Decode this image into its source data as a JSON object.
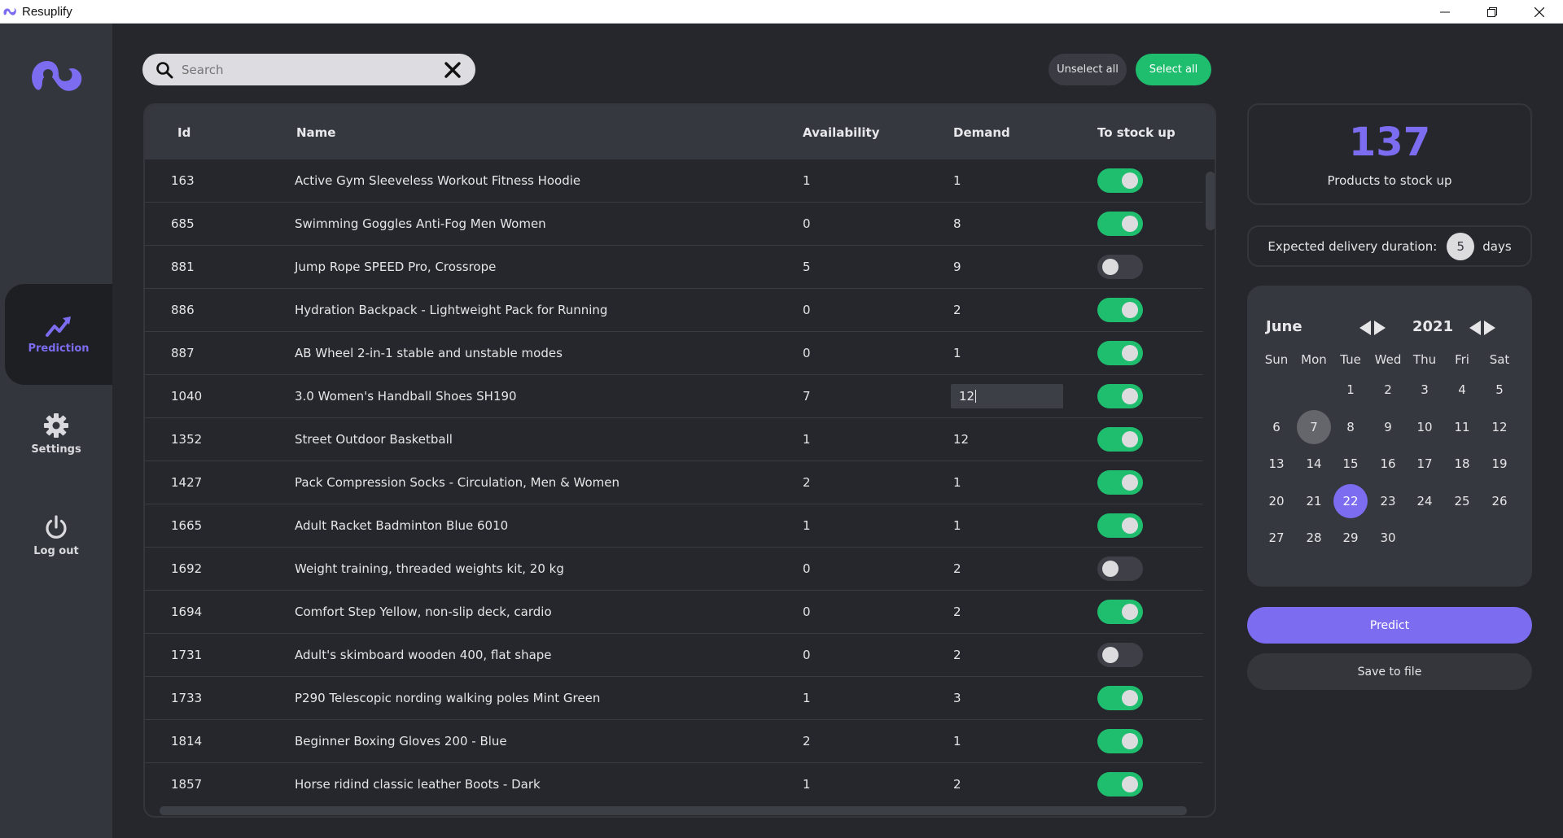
{
  "window": {
    "title": "Resuplify",
    "controls": [
      "minimize-icon",
      "restore-icon",
      "close-icon"
    ]
  },
  "sidebar": {
    "items": [
      {
        "label": "Prediction",
        "icon": "trend-up-icon",
        "active": true
      },
      {
        "label": "Settings",
        "icon": "gear-icon",
        "active": false
      },
      {
        "label": "Log out",
        "icon": "power-icon",
        "active": false
      }
    ]
  },
  "search": {
    "placeholder": "Search",
    "value": ""
  },
  "actions": {
    "unselect_all": "Unselect all",
    "select_all": "Select all"
  },
  "table": {
    "columns": [
      "Id",
      "Name",
      "Availability",
      "Demand",
      "To stock up"
    ],
    "rows": [
      {
        "id": "163",
        "name": "Active Gym Sleeveless Workout Fitness Hoodie",
        "availability": "1",
        "demand": "1",
        "stock": true
      },
      {
        "id": "685",
        "name": "Swimming Goggles Anti-Fog Men Women",
        "availability": "0",
        "demand": "8",
        "stock": true
      },
      {
        "id": "881",
        "name": "Jump Rope SPEED Pro, Crossrope",
        "availability": "5",
        "demand": "9",
        "stock": false
      },
      {
        "id": "886",
        "name": "Hydration Backpack - Lightweight Pack for Running",
        "availability": "0",
        "demand": "2",
        "stock": true
      },
      {
        "id": "887",
        "name": "AB Wheel 2-in-1 stable and unstable modes",
        "availability": "0",
        "demand": "1",
        "stock": true
      },
      {
        "id": "1040",
        "name": "3.0 Women's Handball Shoes SH190",
        "availability": "7",
        "demand": "12",
        "stock": true,
        "editing": true
      },
      {
        "id": "1352",
        "name": "Street Outdoor Basketball",
        "availability": "1",
        "demand": "12",
        "stock": true
      },
      {
        "id": "1427",
        "name": "Pack Compression Socks - Circulation, Men & Women",
        "availability": "2",
        "demand": "1",
        "stock": true
      },
      {
        "id": "1665",
        "name": "Adult Racket Badminton Blue 6010",
        "availability": "1",
        "demand": "1",
        "stock": true
      },
      {
        "id": "1692",
        "name": "Weight training, threaded weights kit, 20 kg",
        "availability": "0",
        "demand": "2",
        "stock": false
      },
      {
        "id": "1694",
        "name": "Comfort Step Yellow, non-slip deck, cardio",
        "availability": "0",
        "demand": "2",
        "stock": true
      },
      {
        "id": "1731",
        "name": "Adult's skimboard wooden 400, flat shape",
        "availability": "0",
        "demand": "2",
        "stock": false
      },
      {
        "id": "1733",
        "name": "P290 Telescopic nording walking poles Mint Green",
        "availability": "1",
        "demand": "3",
        "stock": true
      },
      {
        "id": "1814",
        "name": "Beginner Boxing Gloves 200 - Blue",
        "availability": "2",
        "demand": "1",
        "stock": true
      },
      {
        "id": "1857",
        "name": "Horse ridind classic leather Boots - Dark",
        "availability": "1",
        "demand": "2",
        "stock": true
      }
    ]
  },
  "summary": {
    "count": "137",
    "label": "Products to stock up"
  },
  "delivery": {
    "label": "Expected delivery duration:",
    "value": "5",
    "unit": "days"
  },
  "calendar": {
    "month": "June",
    "year": "2021",
    "weekdays": [
      "Sun",
      "Mon",
      "Tue",
      "Wed",
      "Thu",
      "Fri",
      "Sat"
    ],
    "first_weekday_index": 2,
    "days_in_month": 30,
    "today": 7,
    "selected": 22
  },
  "buttons": {
    "predict": "Predict",
    "save": "Save to file"
  },
  "colors": {
    "accent": "#7b6cf0",
    "toggle_on": "#1fbe6e",
    "background": "#26272c",
    "sidebar": "#34363d"
  }
}
